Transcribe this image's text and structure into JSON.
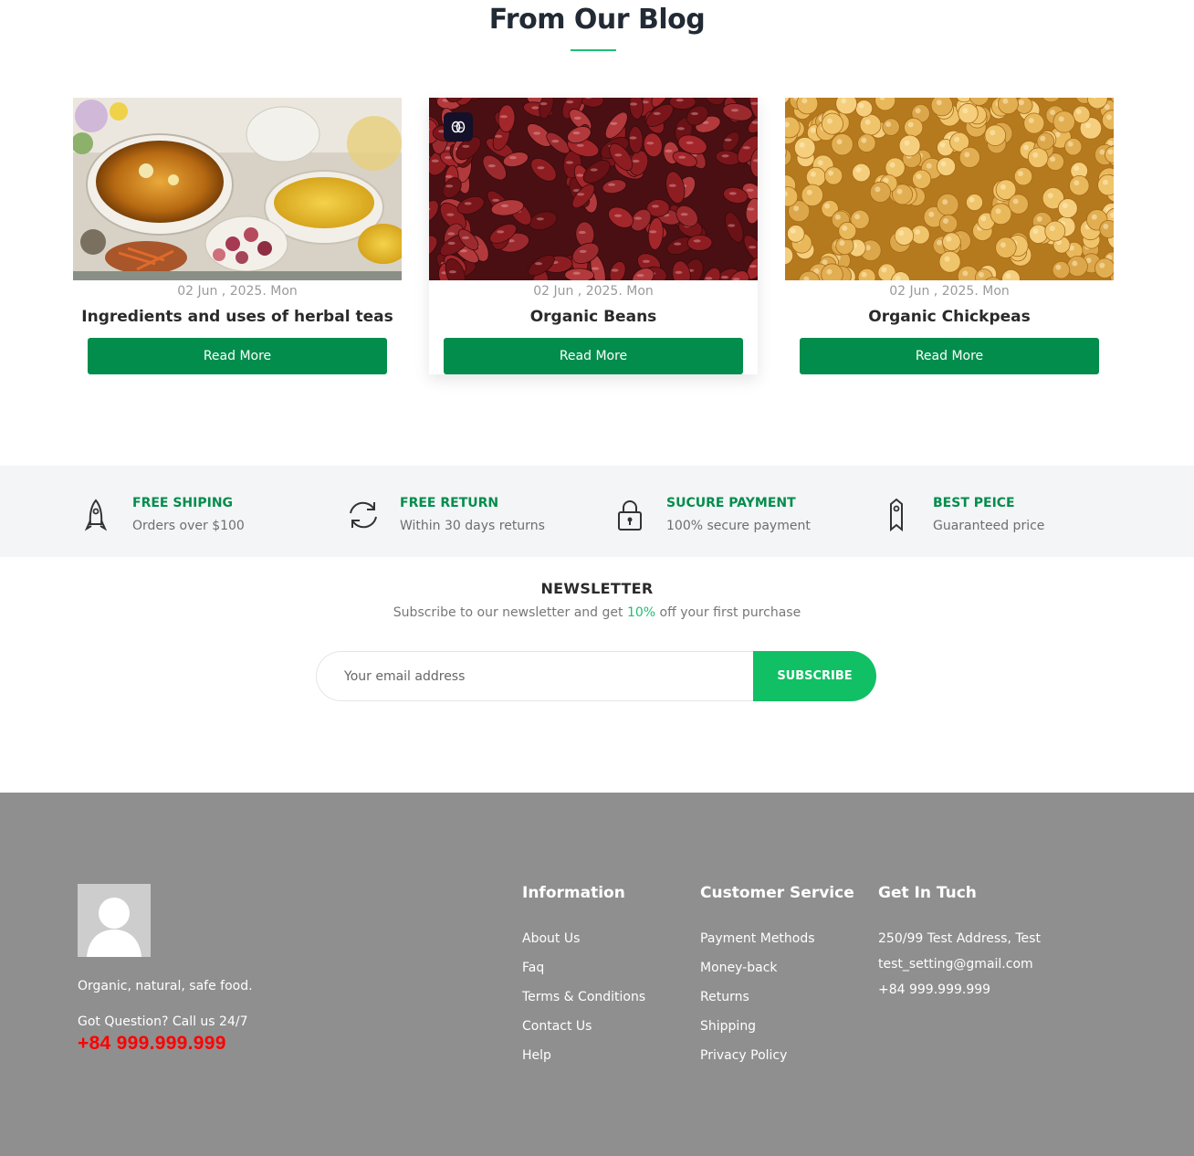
{
  "blog": {
    "title": "From Our Blog",
    "posts": [
      {
        "date": "02 Jun , 2025. Mon",
        "title": "Ingredients and uses of herbal teas",
        "button": "Read More",
        "image": "herbal-tea-photo"
      },
      {
        "date": "02 Jun , 2025. Mon",
        "title": "Organic Beans",
        "button": "Read More",
        "image": "kidney-beans-photo"
      },
      {
        "date": "02 Jun , 2025. Mon",
        "title": "Organic Chickpeas",
        "button": "Read More",
        "image": "chickpeas-photo"
      }
    ]
  },
  "features": [
    {
      "icon": "rocket-icon",
      "title": "FREE SHIPING",
      "subtitle": "Orders over $100"
    },
    {
      "icon": "refresh-icon",
      "title": "FREE RETURN",
      "subtitle": "Within 30 days returns"
    },
    {
      "icon": "lock-icon",
      "title": "SUCURE PAYMENT",
      "subtitle": "100% secure payment"
    },
    {
      "icon": "price-tag-icon",
      "title": "BEST PEICE",
      "subtitle": "Guaranteed price"
    }
  ],
  "newsletter": {
    "title": "NEWSLETTER",
    "subtitle_before": "Subscribe to our newsletter and get ",
    "subtitle_highlight": "10%",
    "subtitle_after": " off your first purchase",
    "placeholder": "Your email address",
    "button": "SUBSCRIBE"
  },
  "footer": {
    "tagline": "Organic, natural, safe food.",
    "question": "Got Question? Call us 24/7",
    "phone": "+84 999.999.999",
    "columns": {
      "information": {
        "title": "Information",
        "links": [
          "About Us",
          "Faq",
          "Terms & Conditions",
          "Contact Us",
          "Help"
        ]
      },
      "customer_service": {
        "title": "Customer Service",
        "links": [
          "Payment Methods",
          "Money-back",
          "Returns",
          "Shipping",
          "Privacy Policy"
        ]
      },
      "get_in_touch": {
        "title": "Get In Tuch",
        "lines": [
          "250/99 Test Address, Test",
          "test_setting@gmail.com",
          "+84 999.999.999"
        ]
      }
    }
  },
  "colors": {
    "primary_green": "#038d4c",
    "accent_green": "#1dbf73",
    "subscribe_green": "#11c064",
    "footer_bg": "#8f8f8f",
    "phone_red": "#ff0000"
  }
}
